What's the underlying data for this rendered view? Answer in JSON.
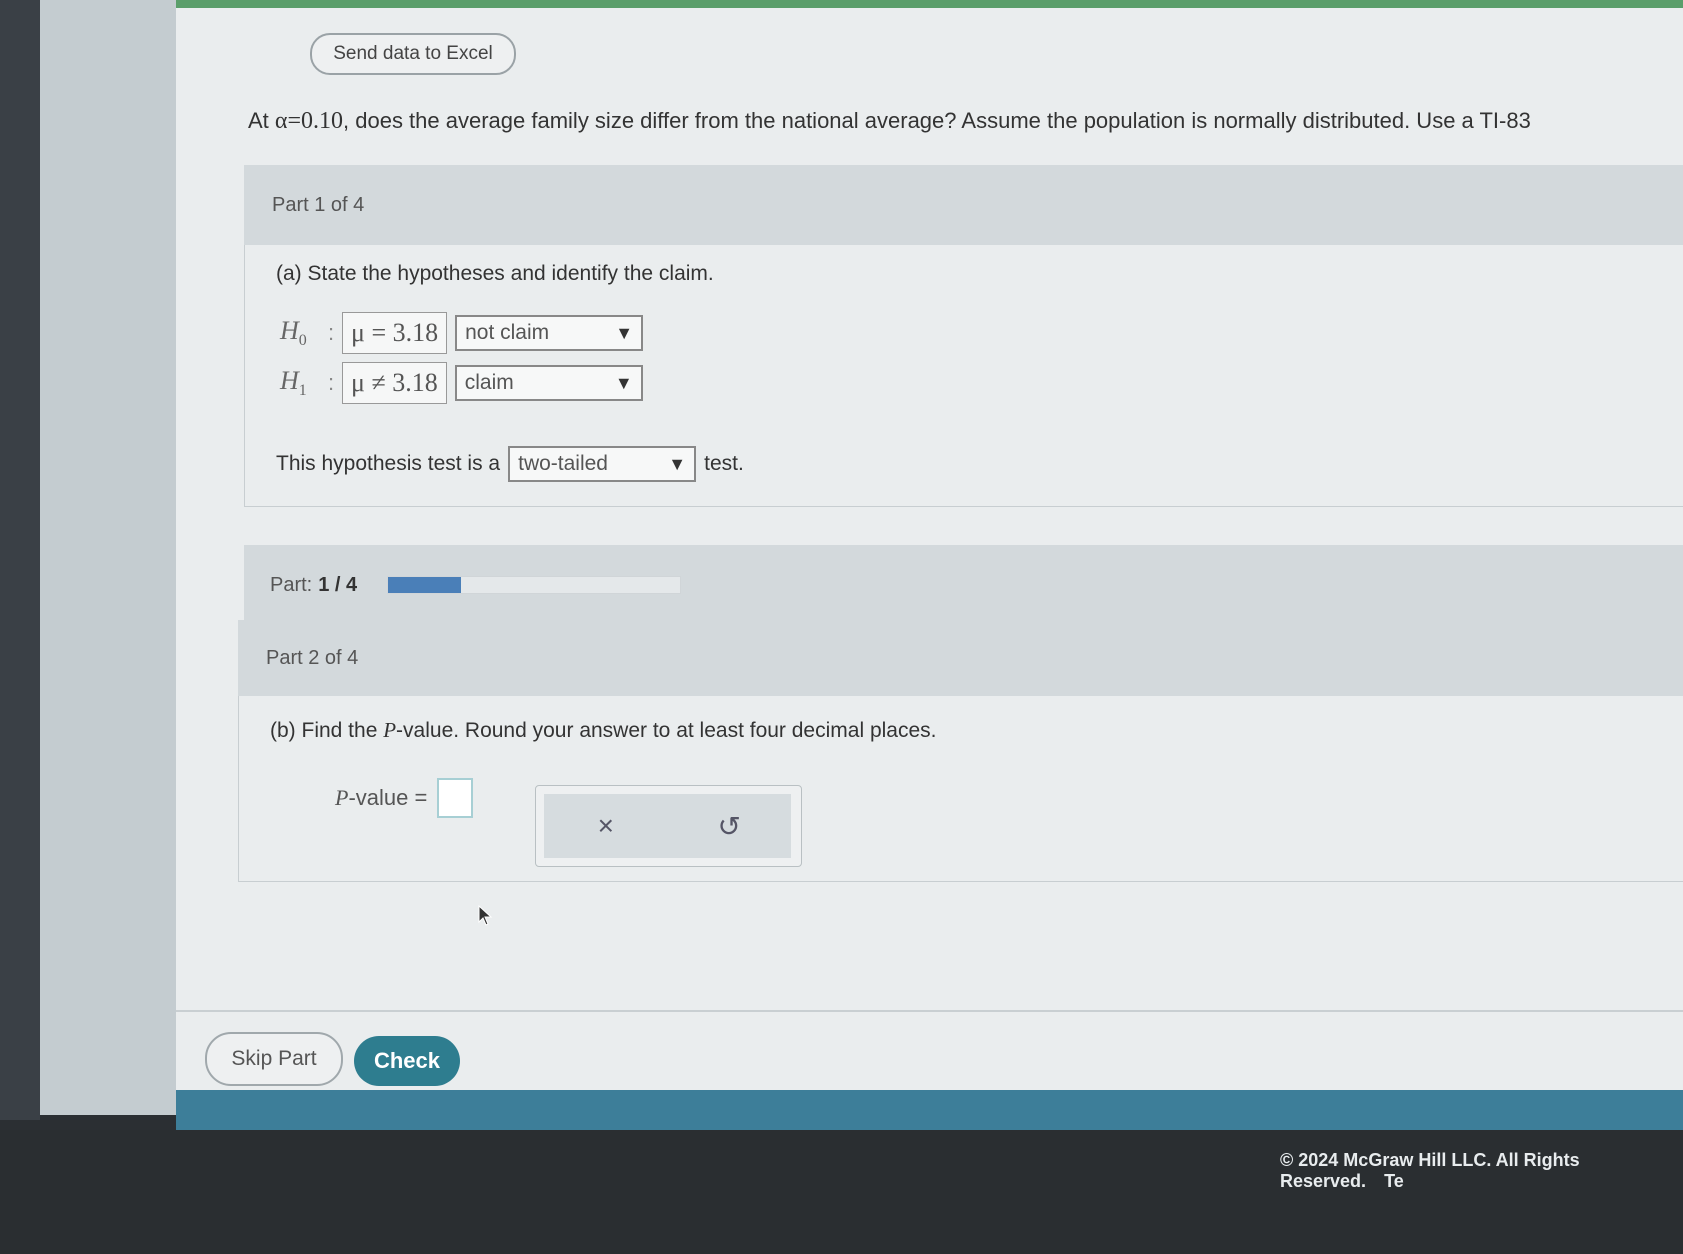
{
  "toolbar": {
    "send_label": "Send data to Excel"
  },
  "question": {
    "prefix": "At ",
    "alpha_expr": "α=0.10",
    "text": ", does the average family size differ from the national average? Assume the population is normally distributed. Use a TI-83"
  },
  "part1": {
    "header": "Part 1 of 4",
    "prompt": "(a) State the hypotheses and identify the claim.",
    "h0": {
      "symbol": "H",
      "sub": "0",
      "expr": "μ = 3.18",
      "selected": "not claim"
    },
    "h1": {
      "symbol": "H",
      "sub": "1",
      "expr": "μ ≠ 3.18",
      "selected": "claim"
    },
    "test_prefix": "This hypothesis test is a",
    "test_selected": "two-tailed",
    "test_suffix": "test."
  },
  "progress": {
    "label": "Part:",
    "value": "1 / 4",
    "fraction": 0.25
  },
  "part2": {
    "header": "Part 2 of 4",
    "prompt_pre": "(b) Find the ",
    "prompt_var": "P",
    "prompt_post": "-value. Round your answer to at least four decimal places.",
    "pvalue_var": "P",
    "pvalue_text": "-value =",
    "input_value": ""
  },
  "tools": {
    "clear_symbol": "×",
    "undo_symbol": "↺"
  },
  "actions": {
    "skip_label": "Skip Part",
    "check_label": "Check"
  },
  "footer": {
    "copyright": "© 2024 McGraw Hill LLC. All Rights Reserved.",
    "tail": "Te"
  },
  "colors": {
    "accent": "#2e7d8f",
    "progress": "#4a7fb8",
    "footer": "#3d7e99"
  }
}
